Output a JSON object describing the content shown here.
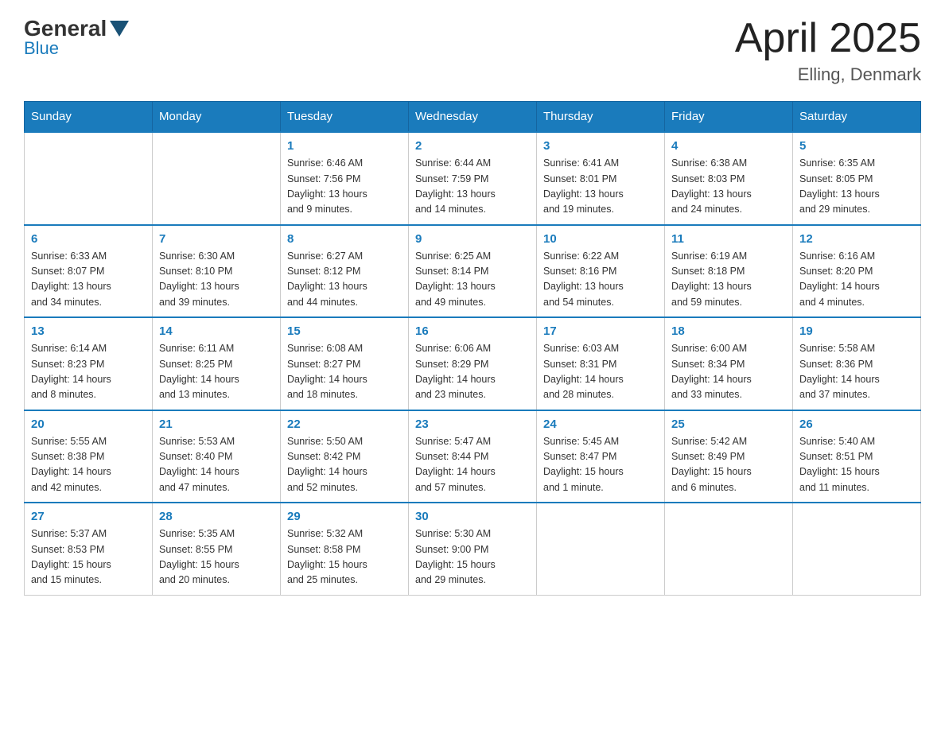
{
  "header": {
    "logo": {
      "text_general": "General",
      "text_blue": "Blue"
    },
    "title": "April 2025",
    "subtitle": "Elling, Denmark"
  },
  "weekdays": [
    "Sunday",
    "Monday",
    "Tuesday",
    "Wednesday",
    "Thursday",
    "Friday",
    "Saturday"
  ],
  "weeks": [
    [
      {
        "day": "",
        "info": ""
      },
      {
        "day": "",
        "info": ""
      },
      {
        "day": "1",
        "info": "Sunrise: 6:46 AM\nSunset: 7:56 PM\nDaylight: 13 hours\nand 9 minutes."
      },
      {
        "day": "2",
        "info": "Sunrise: 6:44 AM\nSunset: 7:59 PM\nDaylight: 13 hours\nand 14 minutes."
      },
      {
        "day": "3",
        "info": "Sunrise: 6:41 AM\nSunset: 8:01 PM\nDaylight: 13 hours\nand 19 minutes."
      },
      {
        "day": "4",
        "info": "Sunrise: 6:38 AM\nSunset: 8:03 PM\nDaylight: 13 hours\nand 24 minutes."
      },
      {
        "day": "5",
        "info": "Sunrise: 6:35 AM\nSunset: 8:05 PM\nDaylight: 13 hours\nand 29 minutes."
      }
    ],
    [
      {
        "day": "6",
        "info": "Sunrise: 6:33 AM\nSunset: 8:07 PM\nDaylight: 13 hours\nand 34 minutes."
      },
      {
        "day": "7",
        "info": "Sunrise: 6:30 AM\nSunset: 8:10 PM\nDaylight: 13 hours\nand 39 minutes."
      },
      {
        "day": "8",
        "info": "Sunrise: 6:27 AM\nSunset: 8:12 PM\nDaylight: 13 hours\nand 44 minutes."
      },
      {
        "day": "9",
        "info": "Sunrise: 6:25 AM\nSunset: 8:14 PM\nDaylight: 13 hours\nand 49 minutes."
      },
      {
        "day": "10",
        "info": "Sunrise: 6:22 AM\nSunset: 8:16 PM\nDaylight: 13 hours\nand 54 minutes."
      },
      {
        "day": "11",
        "info": "Sunrise: 6:19 AM\nSunset: 8:18 PM\nDaylight: 13 hours\nand 59 minutes."
      },
      {
        "day": "12",
        "info": "Sunrise: 6:16 AM\nSunset: 8:20 PM\nDaylight: 14 hours\nand 4 minutes."
      }
    ],
    [
      {
        "day": "13",
        "info": "Sunrise: 6:14 AM\nSunset: 8:23 PM\nDaylight: 14 hours\nand 8 minutes."
      },
      {
        "day": "14",
        "info": "Sunrise: 6:11 AM\nSunset: 8:25 PM\nDaylight: 14 hours\nand 13 minutes."
      },
      {
        "day": "15",
        "info": "Sunrise: 6:08 AM\nSunset: 8:27 PM\nDaylight: 14 hours\nand 18 minutes."
      },
      {
        "day": "16",
        "info": "Sunrise: 6:06 AM\nSunset: 8:29 PM\nDaylight: 14 hours\nand 23 minutes."
      },
      {
        "day": "17",
        "info": "Sunrise: 6:03 AM\nSunset: 8:31 PM\nDaylight: 14 hours\nand 28 minutes."
      },
      {
        "day": "18",
        "info": "Sunrise: 6:00 AM\nSunset: 8:34 PM\nDaylight: 14 hours\nand 33 minutes."
      },
      {
        "day": "19",
        "info": "Sunrise: 5:58 AM\nSunset: 8:36 PM\nDaylight: 14 hours\nand 37 minutes."
      }
    ],
    [
      {
        "day": "20",
        "info": "Sunrise: 5:55 AM\nSunset: 8:38 PM\nDaylight: 14 hours\nand 42 minutes."
      },
      {
        "day": "21",
        "info": "Sunrise: 5:53 AM\nSunset: 8:40 PM\nDaylight: 14 hours\nand 47 minutes."
      },
      {
        "day": "22",
        "info": "Sunrise: 5:50 AM\nSunset: 8:42 PM\nDaylight: 14 hours\nand 52 minutes."
      },
      {
        "day": "23",
        "info": "Sunrise: 5:47 AM\nSunset: 8:44 PM\nDaylight: 14 hours\nand 57 minutes."
      },
      {
        "day": "24",
        "info": "Sunrise: 5:45 AM\nSunset: 8:47 PM\nDaylight: 15 hours\nand 1 minute."
      },
      {
        "day": "25",
        "info": "Sunrise: 5:42 AM\nSunset: 8:49 PM\nDaylight: 15 hours\nand 6 minutes."
      },
      {
        "day": "26",
        "info": "Sunrise: 5:40 AM\nSunset: 8:51 PM\nDaylight: 15 hours\nand 11 minutes."
      }
    ],
    [
      {
        "day": "27",
        "info": "Sunrise: 5:37 AM\nSunset: 8:53 PM\nDaylight: 15 hours\nand 15 minutes."
      },
      {
        "day": "28",
        "info": "Sunrise: 5:35 AM\nSunset: 8:55 PM\nDaylight: 15 hours\nand 20 minutes."
      },
      {
        "day": "29",
        "info": "Sunrise: 5:32 AM\nSunset: 8:58 PM\nDaylight: 15 hours\nand 25 minutes."
      },
      {
        "day": "30",
        "info": "Sunrise: 5:30 AM\nSunset: 9:00 PM\nDaylight: 15 hours\nand 29 minutes."
      },
      {
        "day": "",
        "info": ""
      },
      {
        "day": "",
        "info": ""
      },
      {
        "day": "",
        "info": ""
      }
    ]
  ]
}
